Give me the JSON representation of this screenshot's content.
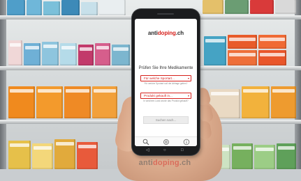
{
  "app": {
    "logo_part1": "anti",
    "logo_part2": "doping",
    "logo_part3": ".ch"
  },
  "main": {
    "heading": "Prüfen Sie Ihre Medikamente",
    "sport_select": "Für welche Sportart...",
    "sport_hint": "Für welche Sportart soll die Abfrage gelten?",
    "country_select": "Produkt gekauft in...",
    "country_hint": "In welchem Land wurde das Produkt gekauft?",
    "search_button": "Suchen nach..."
  },
  "tabbar": {
    "items": [
      {
        "icon": "search-icon"
      },
      {
        "icon": "settings-icon"
      },
      {
        "icon": "info-icon"
      }
    ]
  },
  "watermark": {
    "part1": "anti",
    "part2": "doping",
    "part3": ".ch"
  },
  "colors": {
    "brand_red": "#d6201c",
    "text_dark": "#2a2a2a"
  }
}
